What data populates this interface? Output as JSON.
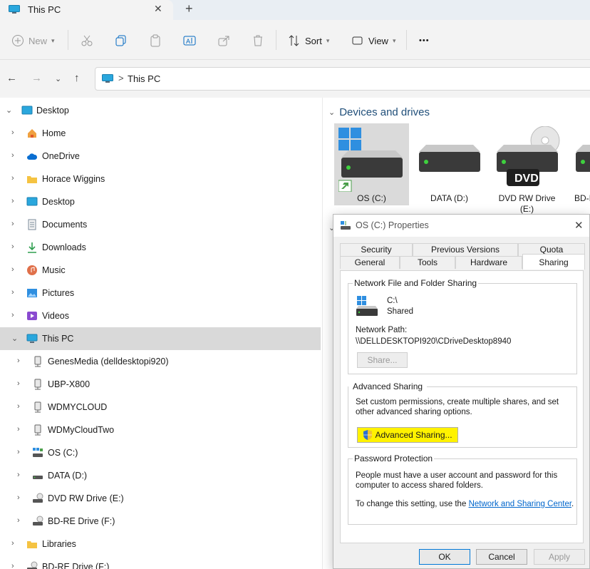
{
  "window": {
    "tab_title": "This PC"
  },
  "toolbar": {
    "new_label": "New",
    "sort_label": "Sort",
    "view_label": "View",
    "more_label": "•••"
  },
  "address": {
    "separator": ">",
    "path": "This PC"
  },
  "nav": {
    "items": [
      {
        "label": "Desktop"
      },
      {
        "label": "Home"
      },
      {
        "label": "OneDrive"
      },
      {
        "label": "Horace Wiggins"
      },
      {
        "label": "Desktop"
      },
      {
        "label": "Documents"
      },
      {
        "label": "Downloads"
      },
      {
        "label": "Music"
      },
      {
        "label": "Pictures"
      },
      {
        "label": "Videos"
      },
      {
        "label": "This PC"
      },
      {
        "label": "GenesMedia (delldesktopi920)"
      },
      {
        "label": "UBP-X800"
      },
      {
        "label": "WDMYCLOUD"
      },
      {
        "label": "WDMyCloudTwo"
      },
      {
        "label": "OS (C:)"
      },
      {
        "label": "DATA (D:)"
      },
      {
        "label": "DVD RW Drive (E:)"
      },
      {
        "label": "BD-RE Drive (F:)"
      },
      {
        "label": "Libraries"
      },
      {
        "label": "BD-RE Drive (F:)"
      }
    ]
  },
  "content": {
    "group_title": "Devices and drives",
    "drives": [
      {
        "label": "OS (C:)"
      },
      {
        "label": "DATA (D:)"
      },
      {
        "label": "DVD RW Drive (E:)",
        "badge": "DVD"
      },
      {
        "label": "BD-I"
      }
    ]
  },
  "dialog": {
    "title": "OS (C:) Properties",
    "tabs_row1": [
      "Security",
      "Previous Versions",
      "Quota"
    ],
    "tabs_row2": [
      "General",
      "Tools",
      "Hardware",
      "Sharing"
    ],
    "network_sharing": {
      "title": "Network File and Folder Sharing",
      "drive": "C:\\",
      "status": "Shared",
      "path_label": "Network Path:",
      "path": "\\\\DELLDESKTOPI920\\CDriveDesktop8940",
      "share_button": "Share..."
    },
    "advanced_sharing": {
      "title": "Advanced Sharing",
      "description": "Set custom permissions, create multiple shares, and set other advanced sharing options.",
      "button": "Advanced Sharing..."
    },
    "password": {
      "title": "Password Protection",
      "description": "People must have a user account and password for this computer to access shared folders.",
      "change_text": "To change this setting, use the",
      "link": "Network and Sharing Center",
      "period": "."
    },
    "buttons": {
      "ok": "OK",
      "cancel": "Cancel",
      "apply": "Apply"
    }
  },
  "colors": {
    "accent": "#0067c0",
    "highlight": "#fff200",
    "selection": "#d9d9d9"
  }
}
